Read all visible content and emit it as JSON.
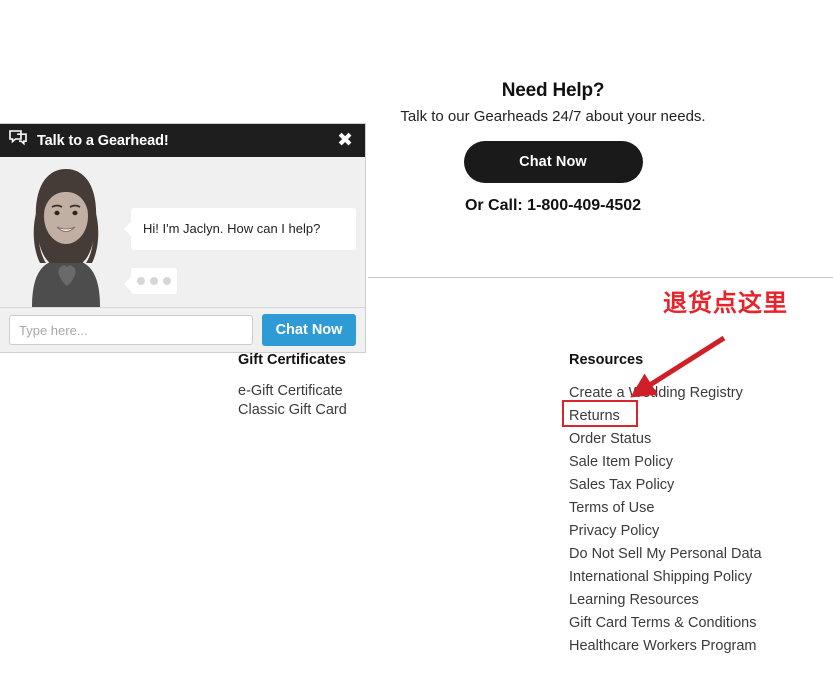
{
  "need_help": {
    "title": "Need Help?",
    "subtitle": "Talk to our Gearheads 24/7 about your needs.",
    "chat_button_label": "Chat Now",
    "phone_line": "Or Call: 1-800-409-4502"
  },
  "gift_certificates": {
    "title": "Gift Certificates",
    "links": [
      "e-Gift Certificate",
      "Classic Gift Card"
    ]
  },
  "resources": {
    "title": "Resources",
    "links": [
      "Create a Wedding Registry",
      "Returns",
      "Order Status",
      "Sale Item Policy",
      "Sales Tax Policy",
      "Terms of Use",
      "Privacy Policy",
      "Do Not Sell My Personal Data",
      "International Shipping Policy",
      "Learning Resources",
      "Gift Card Terms & Conditions",
      "Healthcare Workers Program"
    ]
  },
  "chat_widget": {
    "header_title": "Talk to a Gearhead!",
    "header_icon": "chat-bubbles-icon",
    "close_icon": "close-icon",
    "agent_message": "Hi! I'm Jaclyn. How can I help?",
    "typing_indicator": "•••",
    "input_placeholder": "Type here...",
    "input_value": "",
    "send_button_label": "Chat Now"
  },
  "annotations": {
    "callout_text": "退货点这里",
    "callout_color": "#e8232a",
    "arrow_color": "#cf2027",
    "highlight_target": "Returns",
    "highlight_color": "#d9252a"
  },
  "colors": {
    "chat_header_bg": "#1e1e1e",
    "chat_send_blue": "#2f9bd4",
    "cta_black": "#1a1a1a",
    "link_gray": "#3b3b3b"
  }
}
